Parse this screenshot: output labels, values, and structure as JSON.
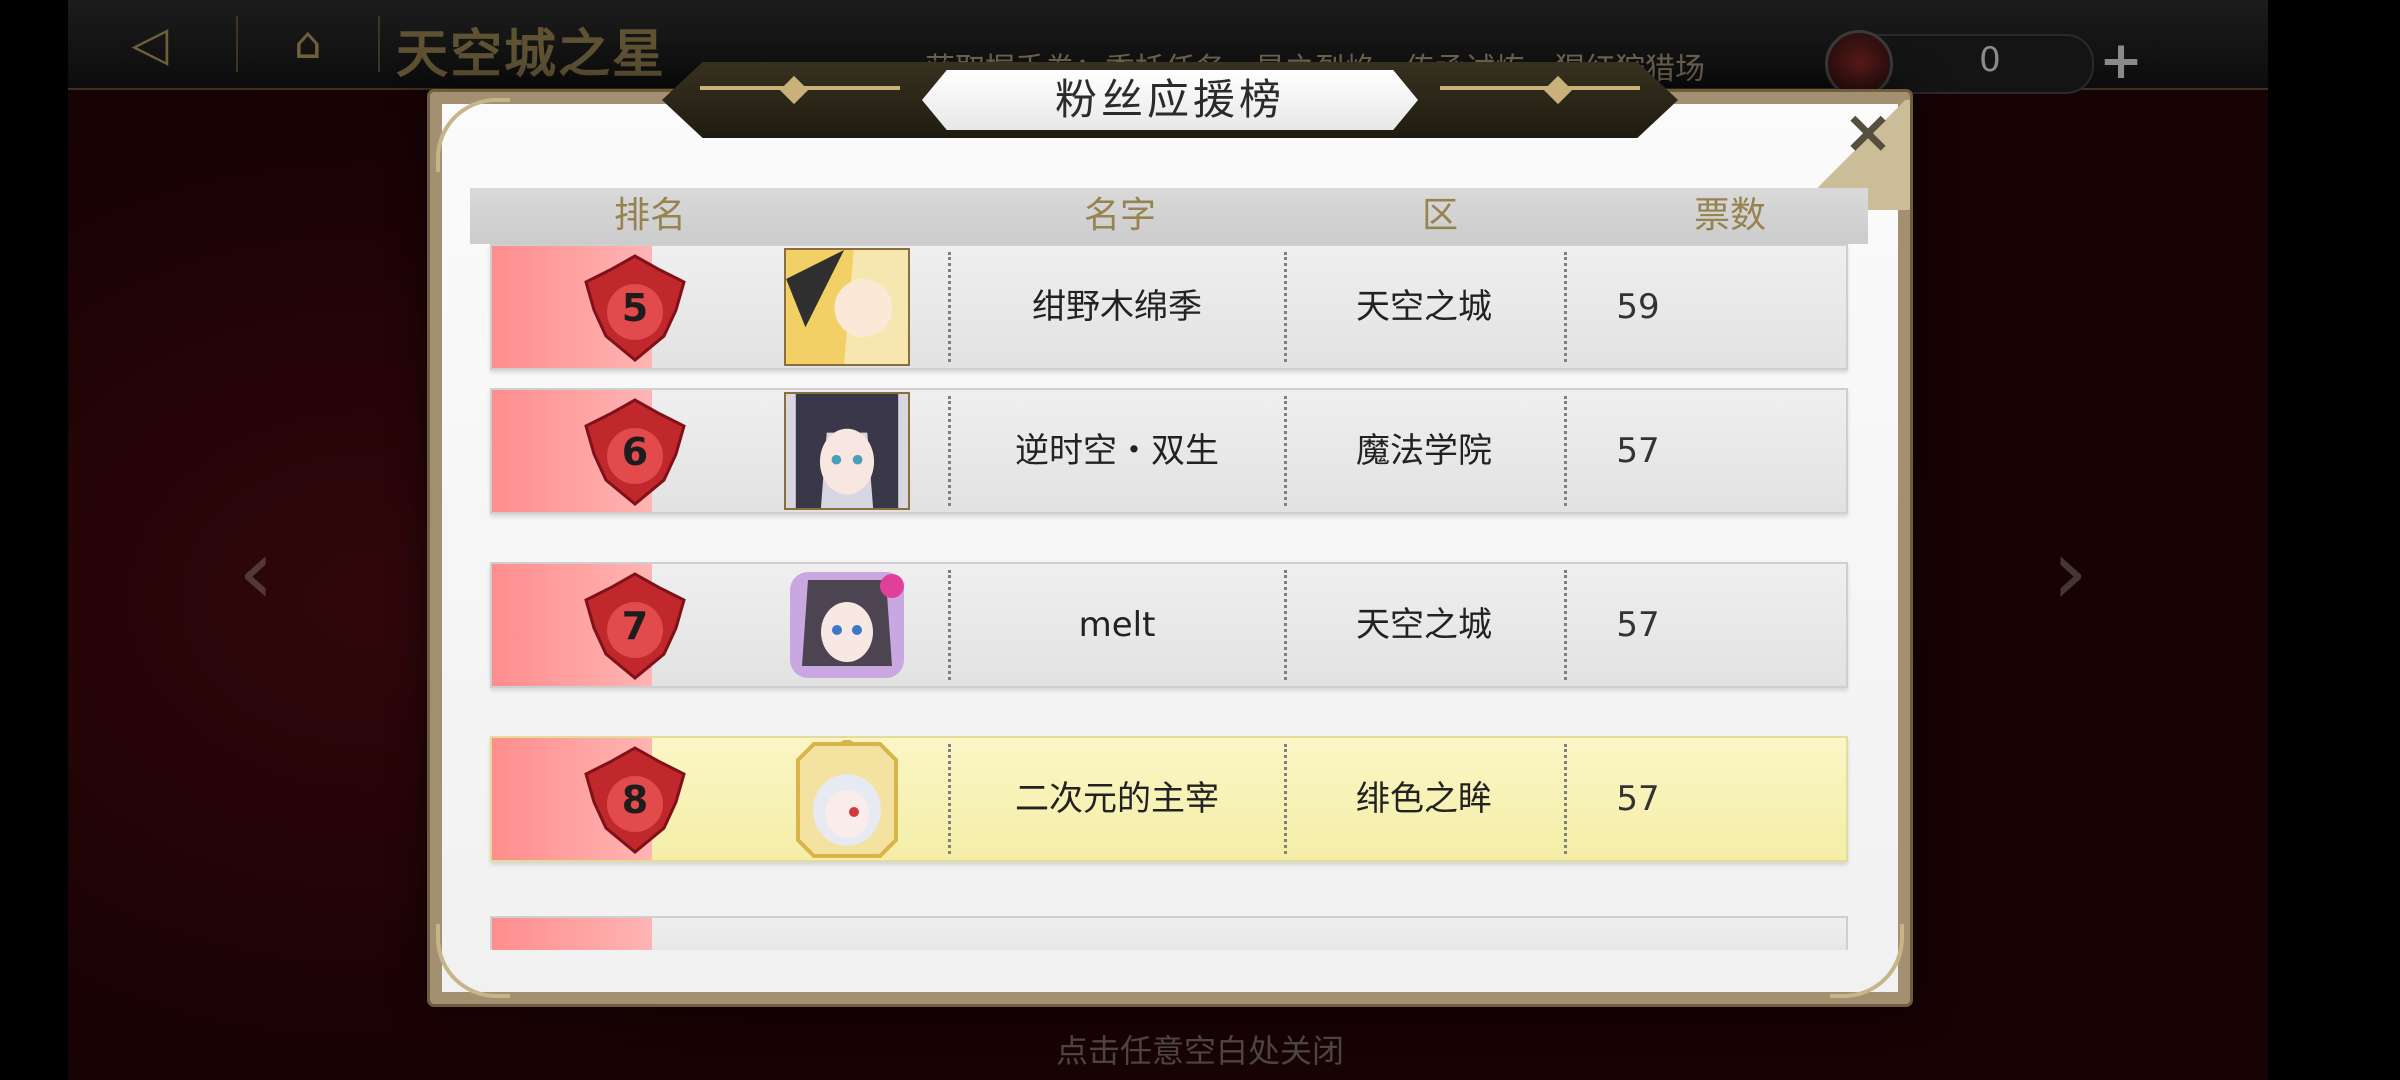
{
  "top_bar": {
    "back_icon": "back-arrow-icon",
    "home_icon": "home-icon",
    "title": "天空城之星",
    "menu": "获取握手券：委托任务　星之烈焰　传承试炼　猩红狩猎场",
    "currency_count": "0",
    "plus_label": "+"
  },
  "modal": {
    "title": "粉丝应援榜",
    "close_label": "×",
    "headers": {
      "rank": "排名",
      "name": "名字",
      "zone": "区",
      "votes": "票数"
    },
    "rows": [
      {
        "rank": "5",
        "name": "绀野木绵季",
        "zone": "天空之城",
        "votes": "59",
        "highlight": false
      },
      {
        "rank": "6",
        "name": "逆时空・双生",
        "zone": "魔法学院",
        "votes": "57",
        "highlight": false
      },
      {
        "rank": "7",
        "name": "melt",
        "zone": "天空之城",
        "votes": "57",
        "highlight": false
      },
      {
        "rank": "8",
        "name": "二次元的主宰",
        "zone": "绯色之眸",
        "votes": "57",
        "highlight": true
      }
    ]
  },
  "footer_hint": "点击任意空白处关闭",
  "colors": {
    "rank_strip": "#ff9a9a",
    "highlight_row": "#f8f2b8",
    "header_text": "#97834f",
    "badge_red": "#c0282c"
  }
}
